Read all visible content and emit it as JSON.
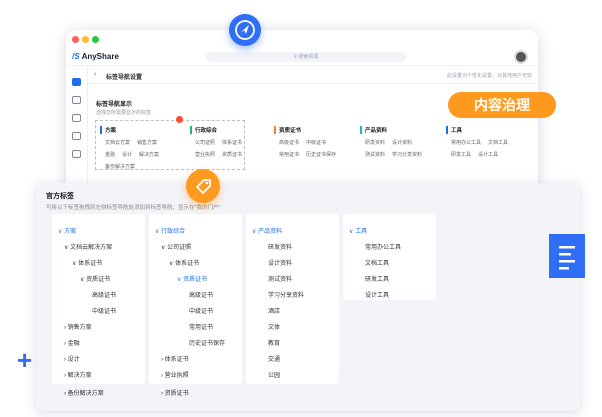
{
  "app": {
    "name": "AnyShare",
    "search_placeholder": "搜索资源"
  },
  "panel": {
    "back_icon": "chevron-left-icon",
    "title": "标签导航设置",
    "tip": "此设置为个性化设置，对其他用户无效"
  },
  "section": {
    "title": "标签导航显示",
    "subtitle": "选择您所需要显示的标签"
  },
  "columns": [
    {
      "title": "方案",
      "rows": [
        [
          "文档云方案",
          "销售方案"
        ],
        [
          "金融",
          "设计",
          "解决方案"
        ],
        [
          "备份解决方案"
        ]
      ]
    },
    {
      "title": "行政综合",
      "rows": [
        [
          "公司证照",
          "体系证书"
        ],
        [
          "营业执照",
          "资质证书"
        ]
      ]
    },
    {
      "title": "资质证书",
      "rows": [
        [
          "高级证书",
          "中级证书"
        ],
        [
          "常用证书",
          "历史证书保存"
        ]
      ]
    },
    {
      "title": "产品资料",
      "rows": [
        [
          "研发资料",
          "设计资料"
        ],
        [
          "测试资料",
          "学习分享资料"
        ]
      ]
    },
    {
      "title": "工具",
      "rows": [
        [
          "常用办公工具",
          "文档工具"
        ],
        [
          "研发工具",
          "设计工具"
        ]
      ]
    }
  ],
  "badge": {
    "label": "内容治理"
  },
  "official": {
    "title": "官方标签",
    "subtitle": "可将以下标签拖拽到左侧标签导航处添加到标签导航，显示在\"我的门户\"",
    "cards": [
      {
        "items": [
          "方案",
          "文档云解决方案",
          "体系证书",
          "资质证书",
          "高级证书",
          "中级证书",
          "销售方案",
          "金融",
          "设计",
          "解决方案",
          "备份解决方案"
        ]
      },
      {
        "items": [
          "行政综合",
          "公司证照",
          "体系证书",
          "资质证书",
          "高级证书",
          "中级证书",
          "常用证书",
          "历史证书保存",
          "体系证书",
          "营业执照",
          "资质证书"
        ]
      },
      {
        "items": [
          "产品资料",
          "研发资料",
          "设计资料",
          "测试资料",
          "学习分享资料",
          "酒店",
          "文体",
          "教育",
          "交通",
          "公园"
        ]
      },
      {
        "items": [
          "工具",
          "常用办公工具",
          "文档工具",
          "研发工具",
          "设计工具"
        ]
      }
    ]
  },
  "icons": {
    "send": "send-icon",
    "tag": "tag-icon",
    "document": "document-icon",
    "plus": "plus-icon"
  },
  "colors": {
    "primary": "#2f6ef5",
    "accent": "#ff9a1f",
    "alert": "#ff4d2e"
  }
}
